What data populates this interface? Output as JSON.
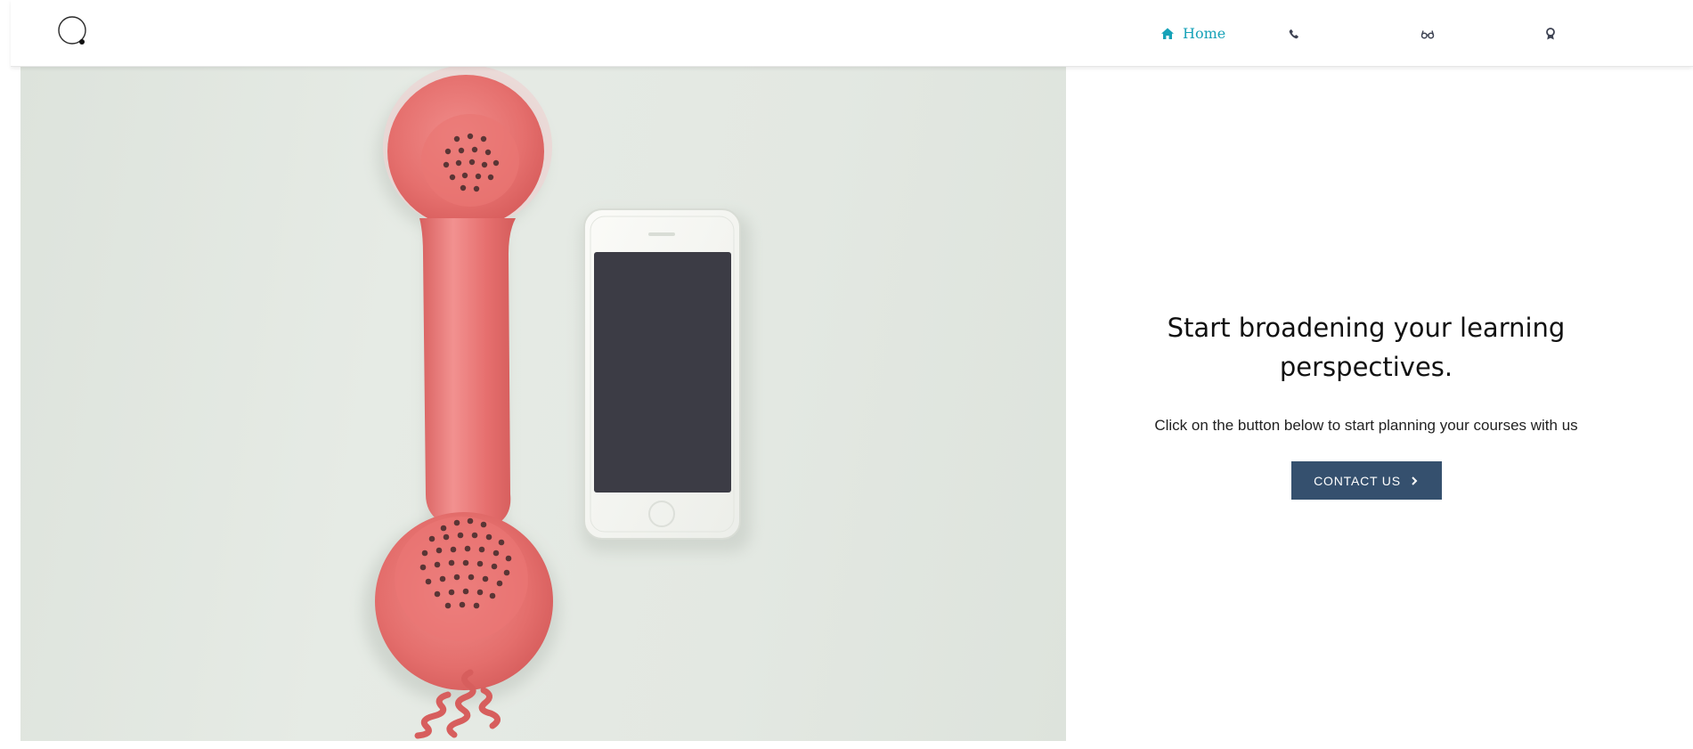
{
  "header": {
    "logo_icon": "circle-logo-icon",
    "nav": [
      {
        "label": "Home",
        "icon": "home-icon",
        "active": true
      },
      {
        "label": "",
        "icon": "phone-icon",
        "active": false
      },
      {
        "label": "",
        "icon": "glasses-icon",
        "active": false
      },
      {
        "label": "",
        "icon": "award-icon",
        "active": false
      }
    ]
  },
  "hero": {
    "image": "red-telephone-handset-and-smartphone-photo"
  },
  "content": {
    "headline": "Start broadening your learning perspectives.",
    "subtext": "Click on the button below to start planning your courses with us",
    "cta_label": "CONTACT US",
    "cta_icon": "chevron-right-icon"
  },
  "colors": {
    "accent": "#17a2b8",
    "button": "#35506e",
    "nav_icon": "#3d4252"
  }
}
